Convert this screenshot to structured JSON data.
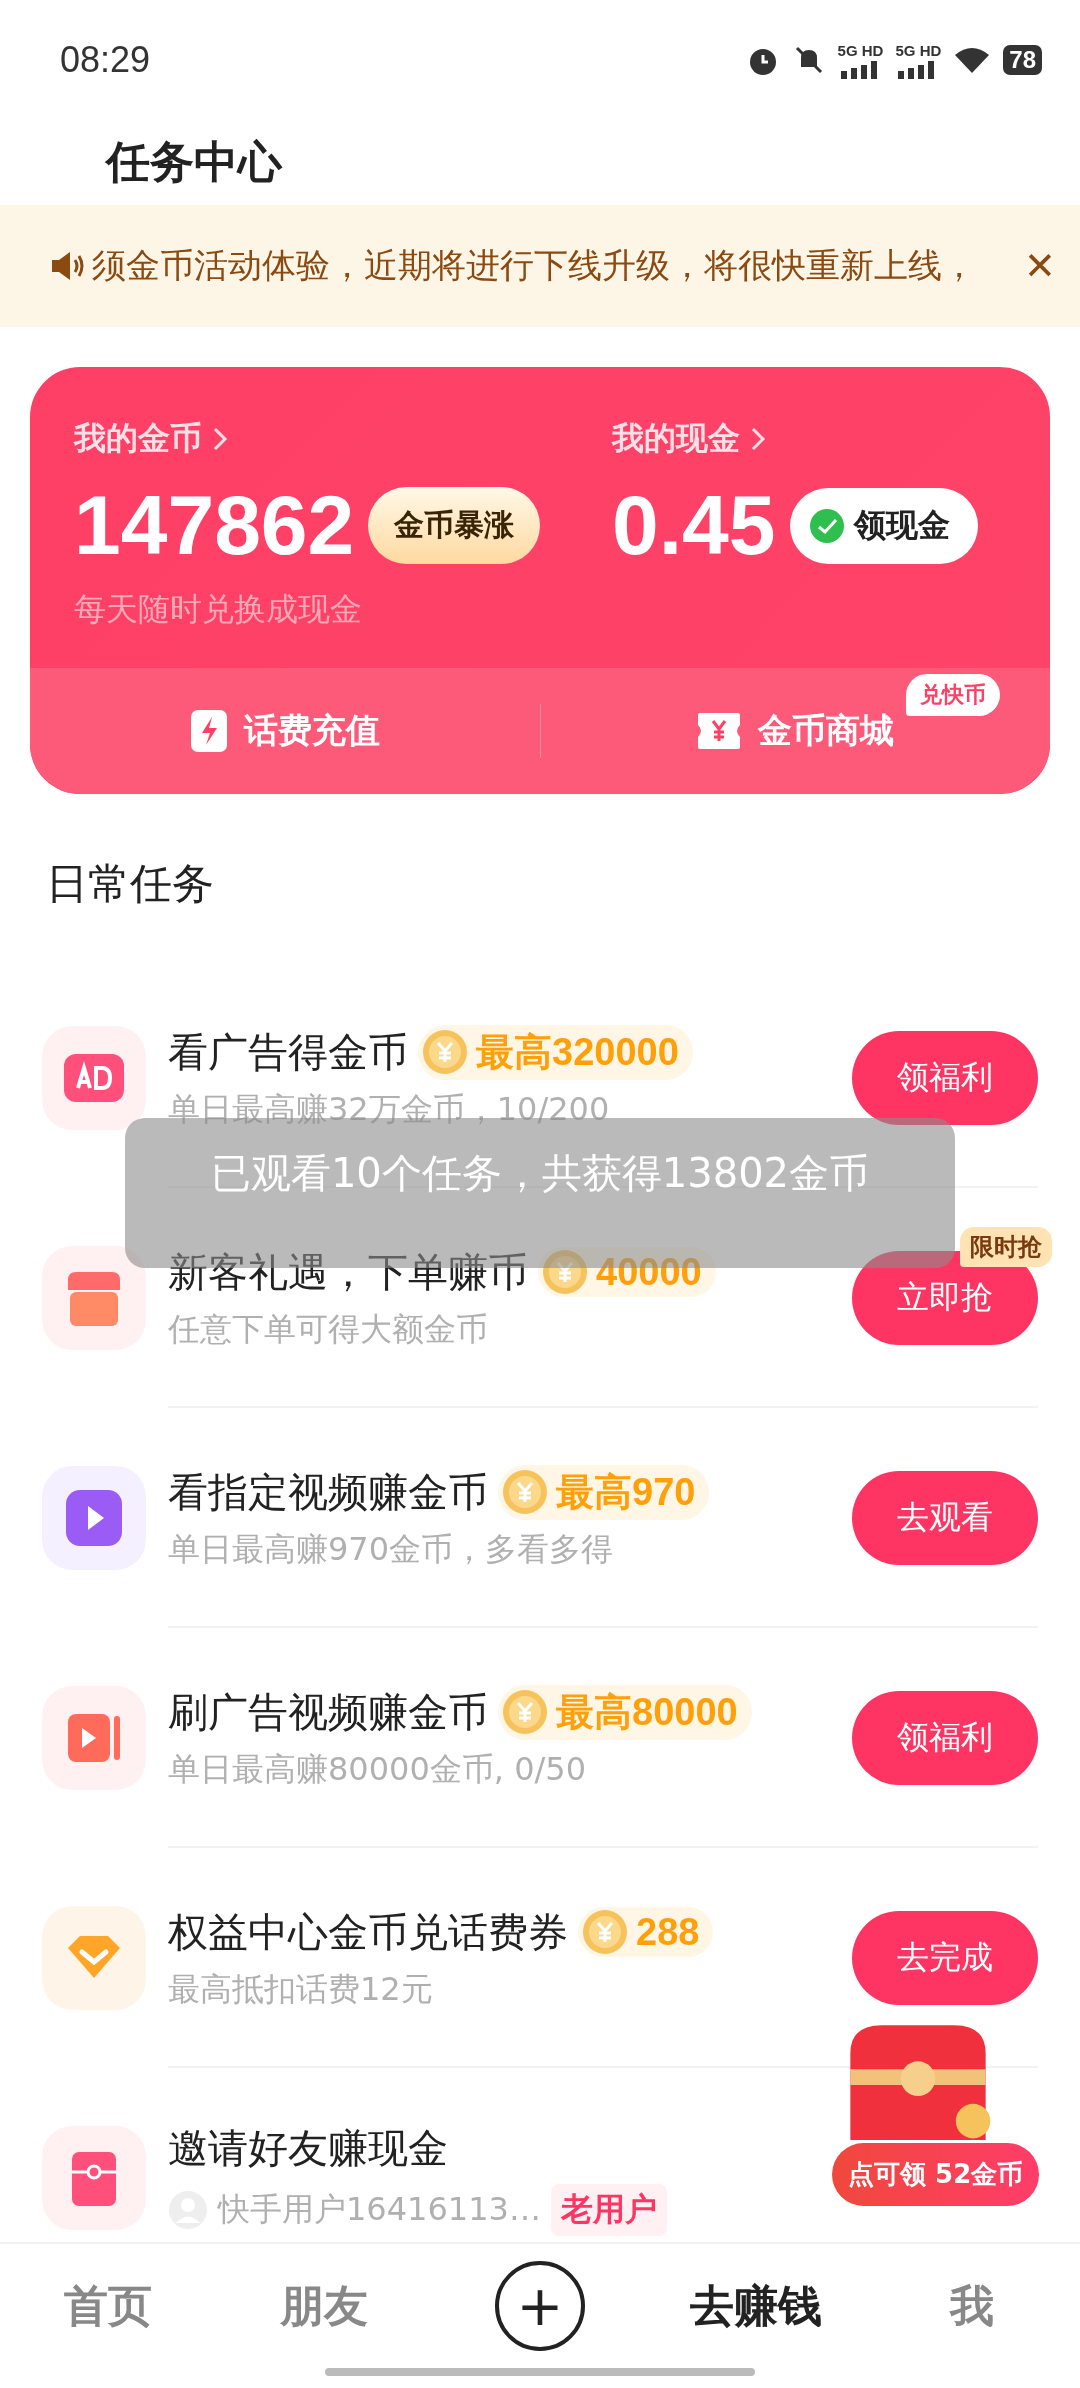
{
  "status_bar": {
    "time": "08:29",
    "battery": "78",
    "network_labels": [
      "5G HD",
      "5G HD"
    ]
  },
  "header": {
    "title": "任务中心"
  },
  "notice": {
    "text": "须金币活动体验，近期将进行下线升级，将很快重新上线，",
    "close": "✕"
  },
  "wallet": {
    "coins_label": "我的金币",
    "coins": "147862",
    "coins_tag": "金币暴涨",
    "cash_label": "我的现金",
    "cash": "0.45",
    "cash_button": "领现金",
    "hint": "每天随时兑换成现金",
    "links": [
      {
        "kind": "bolt",
        "label": "话费充值"
      },
      {
        "kind": "yen",
        "label": "金币商城",
        "badge": "兑快币"
      }
    ]
  },
  "section_title": "日常任务",
  "tasks": [
    {
      "kind": "ad",
      "title": "看广告得金币",
      "reward": "最高320000",
      "subtitle": "单日最高赚32万金币，10/200",
      "button": "领福利"
    },
    {
      "kind": "shop",
      "title": "新客礼遇，下单赚币",
      "reward": "40000",
      "subtitle": "任意下单可得大额金币",
      "button": "立即抢",
      "button_tag": "限时抢"
    },
    {
      "kind": "play",
      "title": "看指定视频赚金币",
      "reward": "最高970",
      "subtitle": "单日最高赚970金币，多看多得",
      "button": "去观看"
    },
    {
      "kind": "video",
      "title": "刷广告视频赚金币",
      "reward": "最高80000",
      "subtitle": "单日最高赚80000金币, 0/50",
      "button": "领福利"
    },
    {
      "kind": "diamond",
      "title": "权益中心金币兑话费券",
      "reward": "288",
      "subtitle": "最高抵扣话费12元",
      "button": "去完成"
    },
    {
      "kind": "envelope",
      "title": "邀请好友赚现金",
      "user": "快手用户16416113…",
      "user_tag": "老用户"
    }
  ],
  "toast": "已观看10个任务，共获得13802金币",
  "chest": {
    "label": "点可领 52金币"
  },
  "nav": [
    {
      "label": "首页",
      "selected": false,
      "kind": "text"
    },
    {
      "label": "朋友",
      "selected": false,
      "kind": "text"
    },
    {
      "kind": "plus",
      "label": "+",
      "selected": false
    },
    {
      "label": "去赚钱",
      "selected": true,
      "kind": "text"
    },
    {
      "label": "我",
      "selected": false,
      "kind": "text"
    }
  ]
}
